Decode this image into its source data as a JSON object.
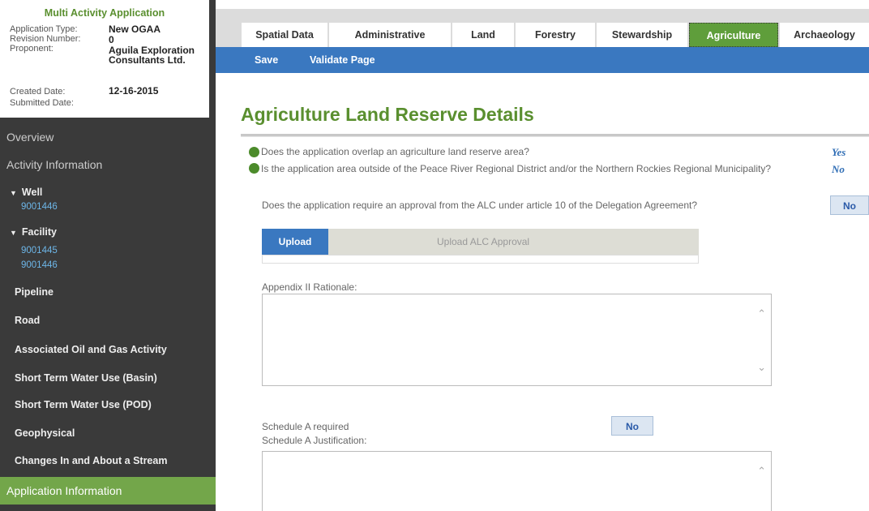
{
  "summary": {
    "title": "Multi Activity Application",
    "fields": [
      {
        "label": "Application Type:",
        "value": "New OGAA"
      },
      {
        "label": "Revision Number:",
        "value": "0"
      },
      {
        "label": "Proponent:",
        "value": "Aguila Exploration Consultants Ltd."
      },
      {
        "label": "Created Date:",
        "value": "12-16-2015"
      },
      {
        "label": "Submitted Date:",
        "value": ""
      }
    ]
  },
  "nav": {
    "overview": "Overview",
    "activity_information": "Activity Information",
    "well": {
      "label": "Well",
      "items": [
        "9001446"
      ]
    },
    "facility": {
      "label": "Facility",
      "items": [
        "9001445",
        "9001446"
      ]
    },
    "pipeline": "Pipeline",
    "road": "Road",
    "associated": "Associated Oil and Gas Activity",
    "stwu_basin": "Short Term Water Use (Basin)",
    "stwu_pod": "Short Term Water Use (POD)",
    "geophysical": "Geophysical",
    "changes_stream": "Changes In and About a Stream",
    "application_information": "Application Information"
  },
  "tabs": [
    "Spatial Data",
    "Administrative",
    "Land",
    "Forestry",
    "Stewardship",
    "Agriculture",
    "Archaeology"
  ],
  "active_tab": "Agriculture",
  "toolbar": {
    "save": "Save",
    "validate": "Validate Page"
  },
  "page": {
    "heading": "Agriculture Land Reserve Details",
    "q1": {
      "text": "Does the application overlap an agriculture land reserve area?",
      "answer": "Yes"
    },
    "q2": {
      "text": "Is the application area outside of the Peace River Regional District and/or the Northern Rockies Regional Municipality?",
      "answer": "No"
    },
    "q3": {
      "text": "Does the application require an approval from the ALC under article 10 of the Delegation Agreement?",
      "answer": "No"
    },
    "upload": {
      "button": "Upload",
      "label": "Upload ALC Approval"
    },
    "appendix_label": "Appendix II Rationale:",
    "schedule_required_label": "Schedule A required",
    "schedule_required_value": "No",
    "schedule_justification_label": "Schedule A Justification:"
  },
  "colors": {
    "brand_green": "#5f9e3b",
    "toolbar_blue": "#3a78c0",
    "sidebar": "#3a3a3a"
  }
}
